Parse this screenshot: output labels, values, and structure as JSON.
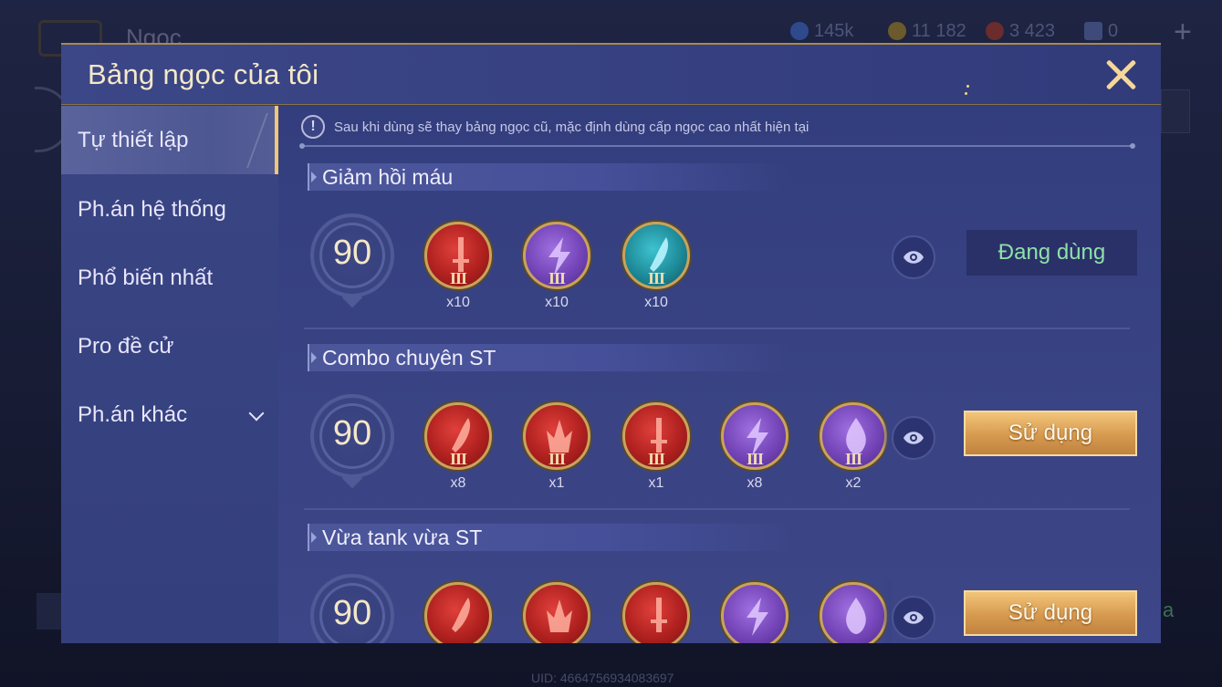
{
  "background": {
    "title": "Ngọc",
    "resources": [
      {
        "icon": "blue-coin-icon",
        "value": "145k",
        "color": "#3b5bb5"
      },
      {
        "icon": "gold-coin-icon",
        "value": "11 182",
        "color": "#b48a2c"
      },
      {
        "icon": "red-gem-icon",
        "value": "3 423",
        "color": "#a03a3a"
      },
      {
        "icon": "card-icon",
        "value": "0",
        "color": "#6a7bb8"
      }
    ],
    "uid": "UID: 4664756934083697",
    "right_green_text": "a"
  },
  "modal": {
    "title": "Bảng ngọc của tôi",
    "close_label": "close"
  },
  "sidebar": {
    "items": [
      {
        "label": "Tự thiết lập",
        "active": true
      },
      {
        "label": "Ph.án hệ thống",
        "active": false
      },
      {
        "label": "Phổ biến nhất",
        "active": false
      },
      {
        "label": "Pro đề cử",
        "active": false
      },
      {
        "label": "Ph.án khác",
        "active": false,
        "has_dropdown": true
      }
    ]
  },
  "notice": {
    "icon": "exclamation-icon",
    "text": "Sau khi dùng sẽ thay bảng ngọc cũ, mặc định dùng cấp ngọc cao nhất hiện tại"
  },
  "sets": [
    {
      "title": "Giảm hồi máu",
      "level": "90",
      "button": "Đang dùng",
      "button_state": "in-use",
      "gems": [
        {
          "color": "red",
          "icon": "sword-icon",
          "tier": "III",
          "count": "x10"
        },
        {
          "color": "purple",
          "icon": "lightning-icon",
          "tier": "III",
          "count": "x10"
        },
        {
          "color": "teal",
          "icon": "blade-icon",
          "tier": "III",
          "count": "x10"
        }
      ]
    },
    {
      "title": "Combo chuyên ST",
      "level": "90",
      "button": "Sử dụng",
      "button_state": "use",
      "gems": [
        {
          "color": "red",
          "icon": "blade-icon",
          "tier": "III",
          "count": "x8"
        },
        {
          "color": "red",
          "icon": "crown-icon",
          "tier": "III",
          "count": "x1"
        },
        {
          "color": "red",
          "icon": "sword-icon",
          "tier": "III",
          "count": "x1"
        },
        {
          "color": "purple",
          "icon": "lightning-icon",
          "tier": "III",
          "count": "x8"
        },
        {
          "color": "purple",
          "icon": "flame-icon",
          "tier": "III",
          "count": "x2"
        }
      ]
    },
    {
      "title": "Vừa tank vừa ST",
      "level": "90",
      "button": "Sử dụng",
      "button_state": "use",
      "gems": [
        {
          "color": "red",
          "icon": "blade-icon",
          "tier": "",
          "count": ""
        },
        {
          "color": "red",
          "icon": "crown-icon",
          "tier": "",
          "count": ""
        },
        {
          "color": "red",
          "icon": "sword-icon",
          "tier": "",
          "count": ""
        },
        {
          "color": "purple",
          "icon": "lightning-icon",
          "tier": "",
          "count": ""
        },
        {
          "color": "purple",
          "icon": "flame-icon",
          "tier": "",
          "count": ""
        }
      ]
    }
  ]
}
